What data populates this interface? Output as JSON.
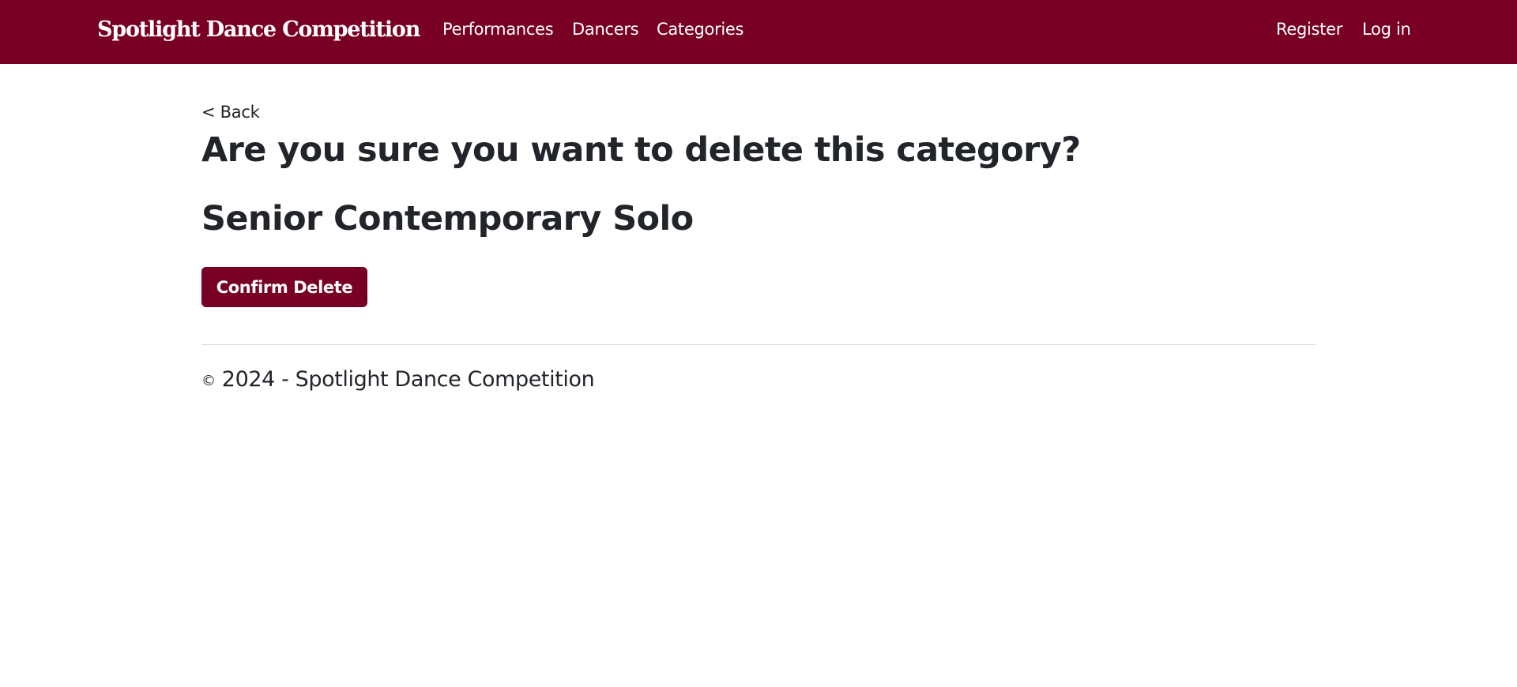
{
  "navbar": {
    "brand": "Spotlight Dance Competition",
    "links": [
      "Performances",
      "Dancers",
      "Categories"
    ],
    "auth": [
      "Register",
      "Log in"
    ],
    "background": "#780024"
  },
  "main": {
    "back_label": "< Back",
    "title": "Are you sure you want to delete this category?",
    "item_name": "Senior Contemporary Solo",
    "confirm_label": "Confirm Delete"
  },
  "footer": {
    "copyright_symbol": "©",
    "text": "2024 - Spotlight Dance Competition"
  },
  "colors": {
    "accent": "#780024",
    "text": "#212529"
  }
}
